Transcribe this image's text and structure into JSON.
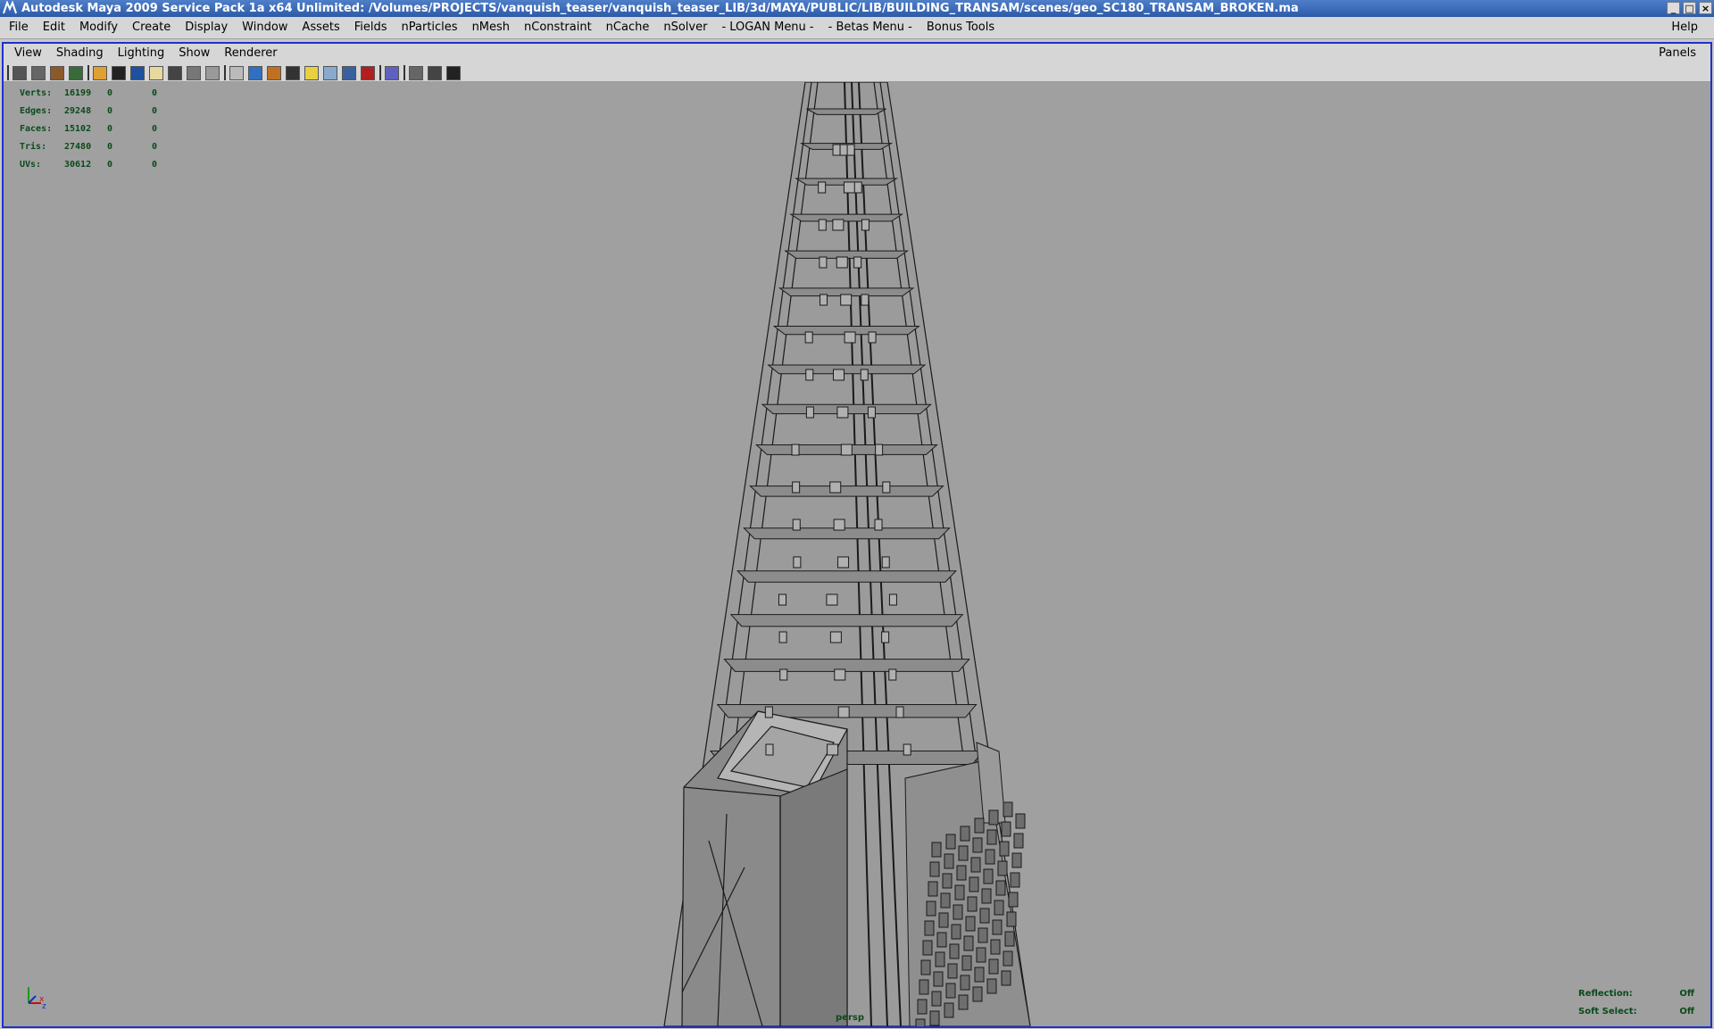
{
  "title": "Autodesk Maya 2009 Service Pack 1a x64 Unlimited: /Volumes/PROJECTS/vanquish_teaser/vanquish_teaser_LIB/3d/MAYA/PUBLIC/LIB/BUILDING_TRANSAM/scenes/geo_SC180_TRANSAM_BROKEN.ma",
  "window_controls": [
    "minimize",
    "maximize",
    "close"
  ],
  "main_menu": [
    "File",
    "Edit",
    "Modify",
    "Create",
    "Display",
    "Window",
    "Assets",
    "Fields",
    "nParticles",
    "nMesh",
    "nConstraint",
    "nCache",
    "nSolver",
    "- LOGAN Menu -",
    "- Betas Menu -",
    "Bonus Tools"
  ],
  "help_menu": "Help",
  "panel_menu": [
    "View",
    "Shading",
    "Lighting",
    "Show",
    "Renderer"
  ],
  "panels_menu": "Panels",
  "toolbar_icons": [
    "camera-attributes-icon",
    "camera-tools-icon",
    "bookmark-icon",
    "image-plane-icon",
    "wireframe-icon",
    "smooth-shade-icon",
    "default-material-icon",
    "textured-icon",
    "grid-icon",
    "film-gate-icon",
    "resolution-gate-icon",
    "gate-mask-icon",
    "isolate-select-icon",
    "xray-icon",
    "use-lights-icon",
    "shadows-icon",
    "high-quality-icon",
    "frame-all-icon",
    "render-view-icon",
    "ipr-icon",
    "snapshot-icon"
  ],
  "hud_stats": [
    {
      "label": "Verts:",
      "v1": "16199",
      "v2": "0",
      "v3": "0"
    },
    {
      "label": "Edges:",
      "v1": "29248",
      "v2": "0",
      "v3": "0"
    },
    {
      "label": "Faces:",
      "v1": "15102",
      "v2": "0",
      "v3": "0"
    },
    {
      "label": "Tris:",
      "v1": "27480",
      "v2": "0",
      "v3": "0"
    },
    {
      "label": "UVs:",
      "v1": "30612",
      "v2": "0",
      "v3": "0"
    }
  ],
  "hud_right": [
    {
      "label": "Reflection:",
      "value": "Off"
    },
    {
      "label": "Soft Select:",
      "value": "Off"
    }
  ],
  "camera_label": "persp",
  "colors": {
    "viewport_bg": "#a0a0a0",
    "panel_border": "#1d32c8",
    "hud_text": "#0a4a1a",
    "titlebar": "#2c5aa8"
  }
}
